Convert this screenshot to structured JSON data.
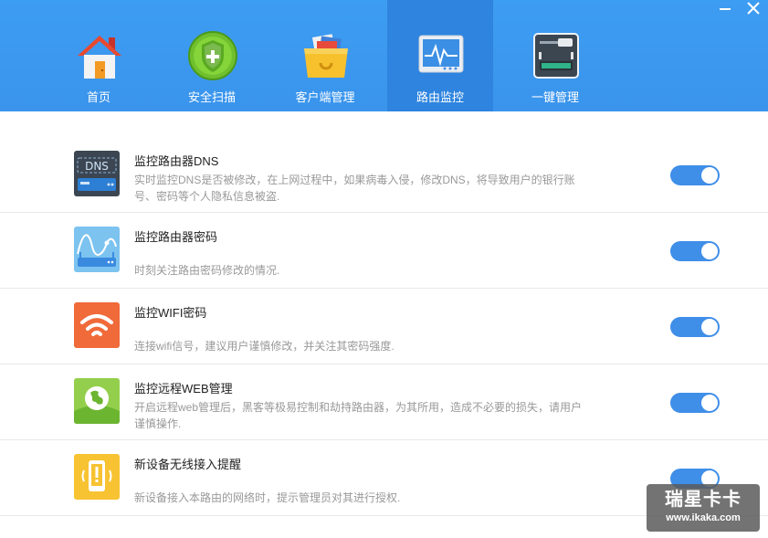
{
  "window": {
    "minimize_icon": "minimize-icon",
    "close_icon": "close-icon"
  },
  "tabs": [
    {
      "label": "首页",
      "icon": "home-icon"
    },
    {
      "label": "安全扫描",
      "icon": "shield-plus-icon"
    },
    {
      "label": "客户端管理",
      "icon": "box-icon"
    },
    {
      "label": "路由监控",
      "icon": "monitor-chart-icon",
      "active": true
    },
    {
      "label": "一键管理",
      "icon": "control-panel-icon"
    }
  ],
  "items": [
    {
      "title": "监控路由器DNS",
      "desc": "实时监控DNS是否被修改，在上网过程中，如果病毒入侵，修改DNS，将导致用户的银行账号、密码等个人隐私信息被盗.",
      "icon": "dns-router-icon",
      "icon_text": "DNS",
      "enabled": true
    },
    {
      "title": "监控路由器密码",
      "desc": "时刻关注路由密码修改的情况.",
      "icon": "router-password-icon",
      "enabled": true
    },
    {
      "title": "监控WIFI密码",
      "desc": "连接wifi信号，建议用户谨慎修改，并关注其密码强度.",
      "icon": "wifi-icon",
      "enabled": true
    },
    {
      "title": "监控远程WEB管理",
      "desc": "开启远程web管理后，黑客等极易控制和劫持路由器，为其所用，造成不必要的损失，请用户谨慎操作.",
      "icon": "globe-icon",
      "enabled": true
    },
    {
      "title": "新设备无线接入提醒",
      "desc": "新设备接入本路由的网络时，提示管理员对其进行授权.",
      "icon": "phone-alert-icon",
      "enabled": true
    }
  ],
  "watermark": {
    "line1": "瑞星卡卡",
    "line2": "www.ikaka.com"
  },
  "colors": {
    "header": "#3a94ec",
    "active_tab": "#2e84de",
    "toggle_on": "#3f8ee8"
  }
}
